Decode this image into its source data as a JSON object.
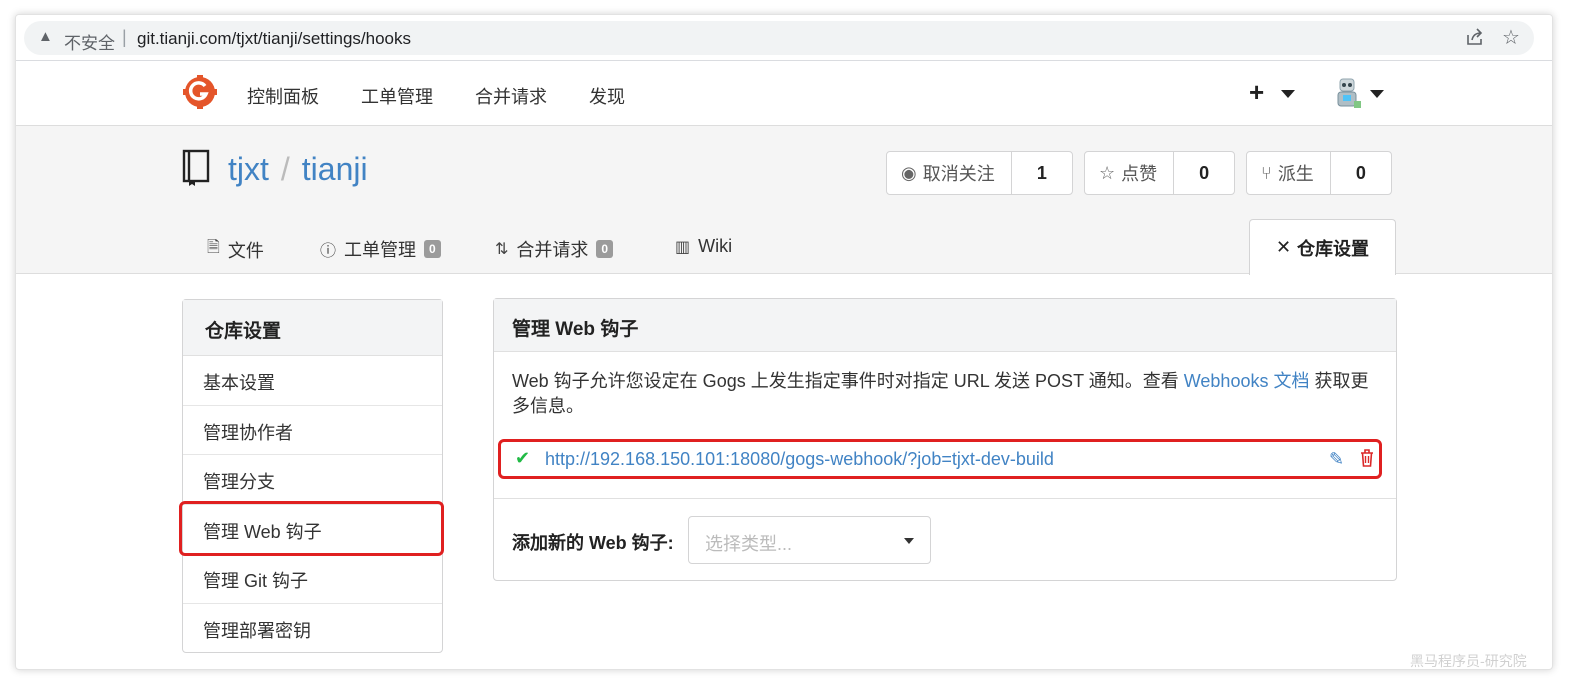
{
  "browser": {
    "warning_icon": "warning-triangle-icon",
    "insecure_label": "不安全",
    "separator": "|",
    "url": "git.tianji.com/tjxt/tianji/settings/hooks",
    "share_icon": "share-icon",
    "bookmark_icon": "star-icon"
  },
  "topnav": {
    "logo_icon": "gogs-logo-icon",
    "items": [
      "控制面板",
      "工单管理",
      "合并请求",
      "发现"
    ],
    "plus_label": "+",
    "avatar_icon": "avatar-icon"
  },
  "repo": {
    "owner": "tjxt",
    "slash": "/",
    "name": "tianji",
    "watch": {
      "label": "取消关注",
      "count": "1",
      "icon": "eye-icon"
    },
    "star": {
      "label": "点赞",
      "count": "0",
      "icon": "star-outline-icon"
    },
    "fork": {
      "label": "派生",
      "count": "0",
      "icon": "fork-icon"
    },
    "tabs": [
      {
        "label": "文件",
        "icon": "file-icon"
      },
      {
        "label": "工单管理",
        "badge": "0",
        "icon": "issue-icon"
      },
      {
        "label": "合并请求",
        "badge": "0",
        "icon": "pull-request-icon"
      },
      {
        "label": "Wiki",
        "icon": "wiki-icon"
      }
    ],
    "settings_tab": {
      "label": "仓库设置",
      "icon": "tools-icon"
    }
  },
  "sidebar": {
    "title": "仓库设置",
    "items": [
      "基本设置",
      "管理协作者",
      "管理分支",
      "管理 Web 钩子",
      "管理 Git 钩子",
      "管理部署密钥"
    ],
    "active_index": 3
  },
  "main": {
    "title": "管理 Web 钩子",
    "desc_before": "Web 钩子允许您设定在 Gogs 上发生指定事件时对指定 URL 发送 POST 通知。查看 ",
    "desc_link": "Webhooks 文档",
    "desc_after": " 获取更多信息。",
    "hook": {
      "url": "http://192.168.150.101:18080/gogs-webhook/?job=tjxt-dev-build",
      "status_icon": "check-icon",
      "edit_icon": "pencil-icon",
      "delete_icon": "trash-icon"
    },
    "add_label": "添加新的 Web 钩子:",
    "select_placeholder": "选择类型..."
  },
  "watermark": "黑马程序员-研究院",
  "colors": {
    "link": "#4183c4",
    "highlight_box": "#e02020",
    "success": "#21ba45",
    "danger": "#db2828",
    "logo": "#e4552a"
  }
}
